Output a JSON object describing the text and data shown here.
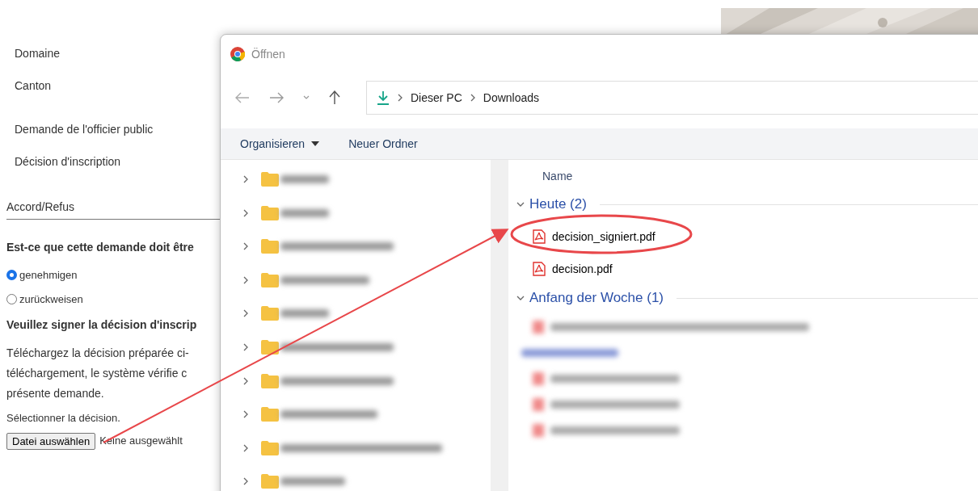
{
  "page": {
    "fields": [
      "Domaine",
      "Canton",
      "Demande de l'officier public",
      "Décision d'inscription"
    ],
    "section_title": "Accord/Refus",
    "question": "Est-ce que cette demande doit être",
    "radios": [
      {
        "label": "genehmigen",
        "selected": true
      },
      {
        "label": "zurückweisen",
        "selected": false
      }
    ],
    "heading": "Veuillez signer la décision d'inscrip",
    "paragraph_lines": [
      "Téléchargez la décision préparée ci-",
      "téléchargement, le système vérifie c",
      "présente demande."
    ],
    "file_label": "Sélectionner la décision.",
    "file_button": "Datei auswählen",
    "file_status": "Keine ausgewählt"
  },
  "dialog": {
    "title": "Öffnen",
    "breadcrumb": [
      "Dieser PC",
      "Downloads"
    ],
    "toolbar": [
      {
        "label": "Organisieren",
        "kind": "menu"
      },
      {
        "label": "Neuer Ordner",
        "kind": "button"
      }
    ],
    "column_header": "Name",
    "groups": [
      {
        "label": "Heute (2)",
        "expanded": true,
        "files": [
          "decision_signiert.pdf",
          "decision.pdf"
        ]
      },
      {
        "label": "Anfang der Woche (1)",
        "expanded": true
      }
    ]
  }
}
